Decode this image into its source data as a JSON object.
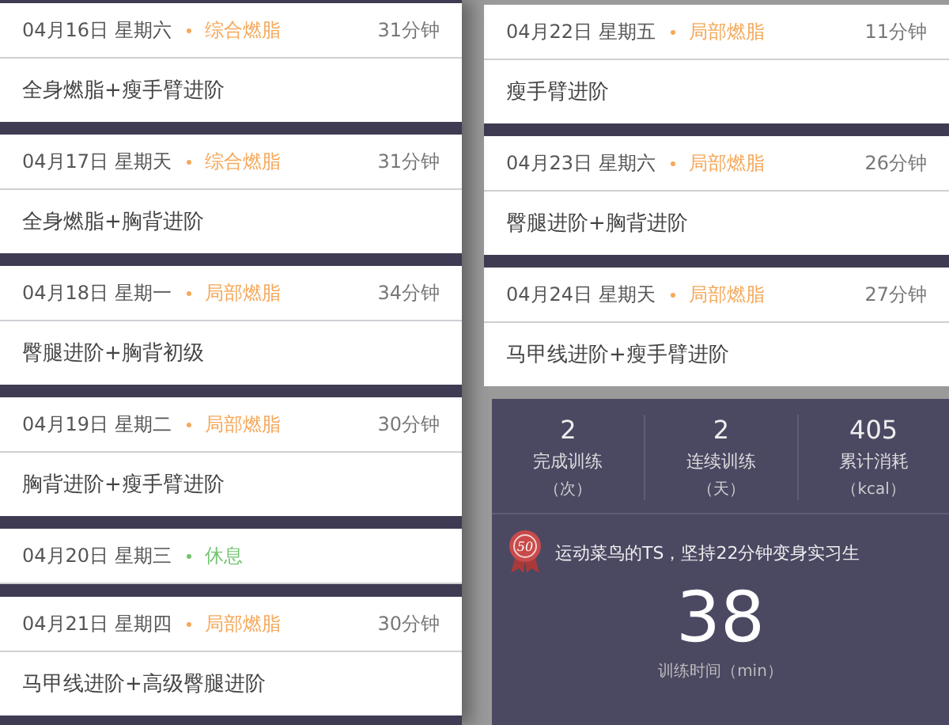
{
  "days_left": [
    {
      "date": "04月16日 星期六",
      "tag": {
        "text": "综合燃脂",
        "color": "#f5a95c"
      },
      "duration": "31分钟",
      "plan": "全身燃脂+瘦手臂进阶"
    },
    {
      "date": "04月17日 星期天",
      "tag": {
        "text": "综合燃脂",
        "color": "#f5a95c"
      },
      "duration": "31分钟",
      "plan": "全身燃脂+胸背进阶"
    },
    {
      "date": "04月18日 星期一",
      "tag": {
        "text": "局部燃脂",
        "color": "#f5a95c"
      },
      "duration": "34分钟",
      "plan": "臀腿进阶+胸背初级"
    },
    {
      "date": "04月19日 星期二",
      "tag": {
        "text": "局部燃脂",
        "color": "#f5a95c"
      },
      "duration": "30分钟",
      "plan": "胸背进阶+瘦手臂进阶"
    },
    {
      "date": "04月20日 星期三",
      "tag": {
        "text": "休息",
        "color": "#72c46f"
      }
    },
    {
      "date": "04月21日 星期四",
      "tag": {
        "text": "局部燃脂",
        "color": "#f5a95c"
      },
      "duration": "30分钟",
      "plan": "马甲线进阶+高级臀腿进阶"
    }
  ],
  "days_right": [
    {
      "date": "04月22日 星期五",
      "tag": {
        "text": "局部燃脂",
        "color": "#f5a95c"
      },
      "duration": "11分钟",
      "plan": "瘦手臂进阶"
    },
    {
      "date": "04月23日 星期六",
      "tag": {
        "text": "局部燃脂",
        "color": "#f5a95c"
      },
      "duration": "26分钟",
      "plan": "臀腿进阶+胸背进阶"
    },
    {
      "date": "04月24日 星期天",
      "tag": {
        "text": "局部燃脂",
        "color": "#f5a95c"
      },
      "duration": "27分钟",
      "plan": "马甲线进阶+瘦手臂进阶"
    }
  ],
  "stats": [
    {
      "value": "2",
      "label": "完成训练",
      "unit": "（次）"
    },
    {
      "value": "2",
      "label": "连续训练",
      "unit": "（天）"
    },
    {
      "value": "405",
      "label": "累计消耗",
      "unit": "（kcal）"
    }
  ],
  "badge": {
    "number": "50",
    "message": "运动菜鸟的TS，坚持22分钟变身实习生"
  },
  "training_time": {
    "value": "38",
    "label": "训练时间（min）"
  }
}
